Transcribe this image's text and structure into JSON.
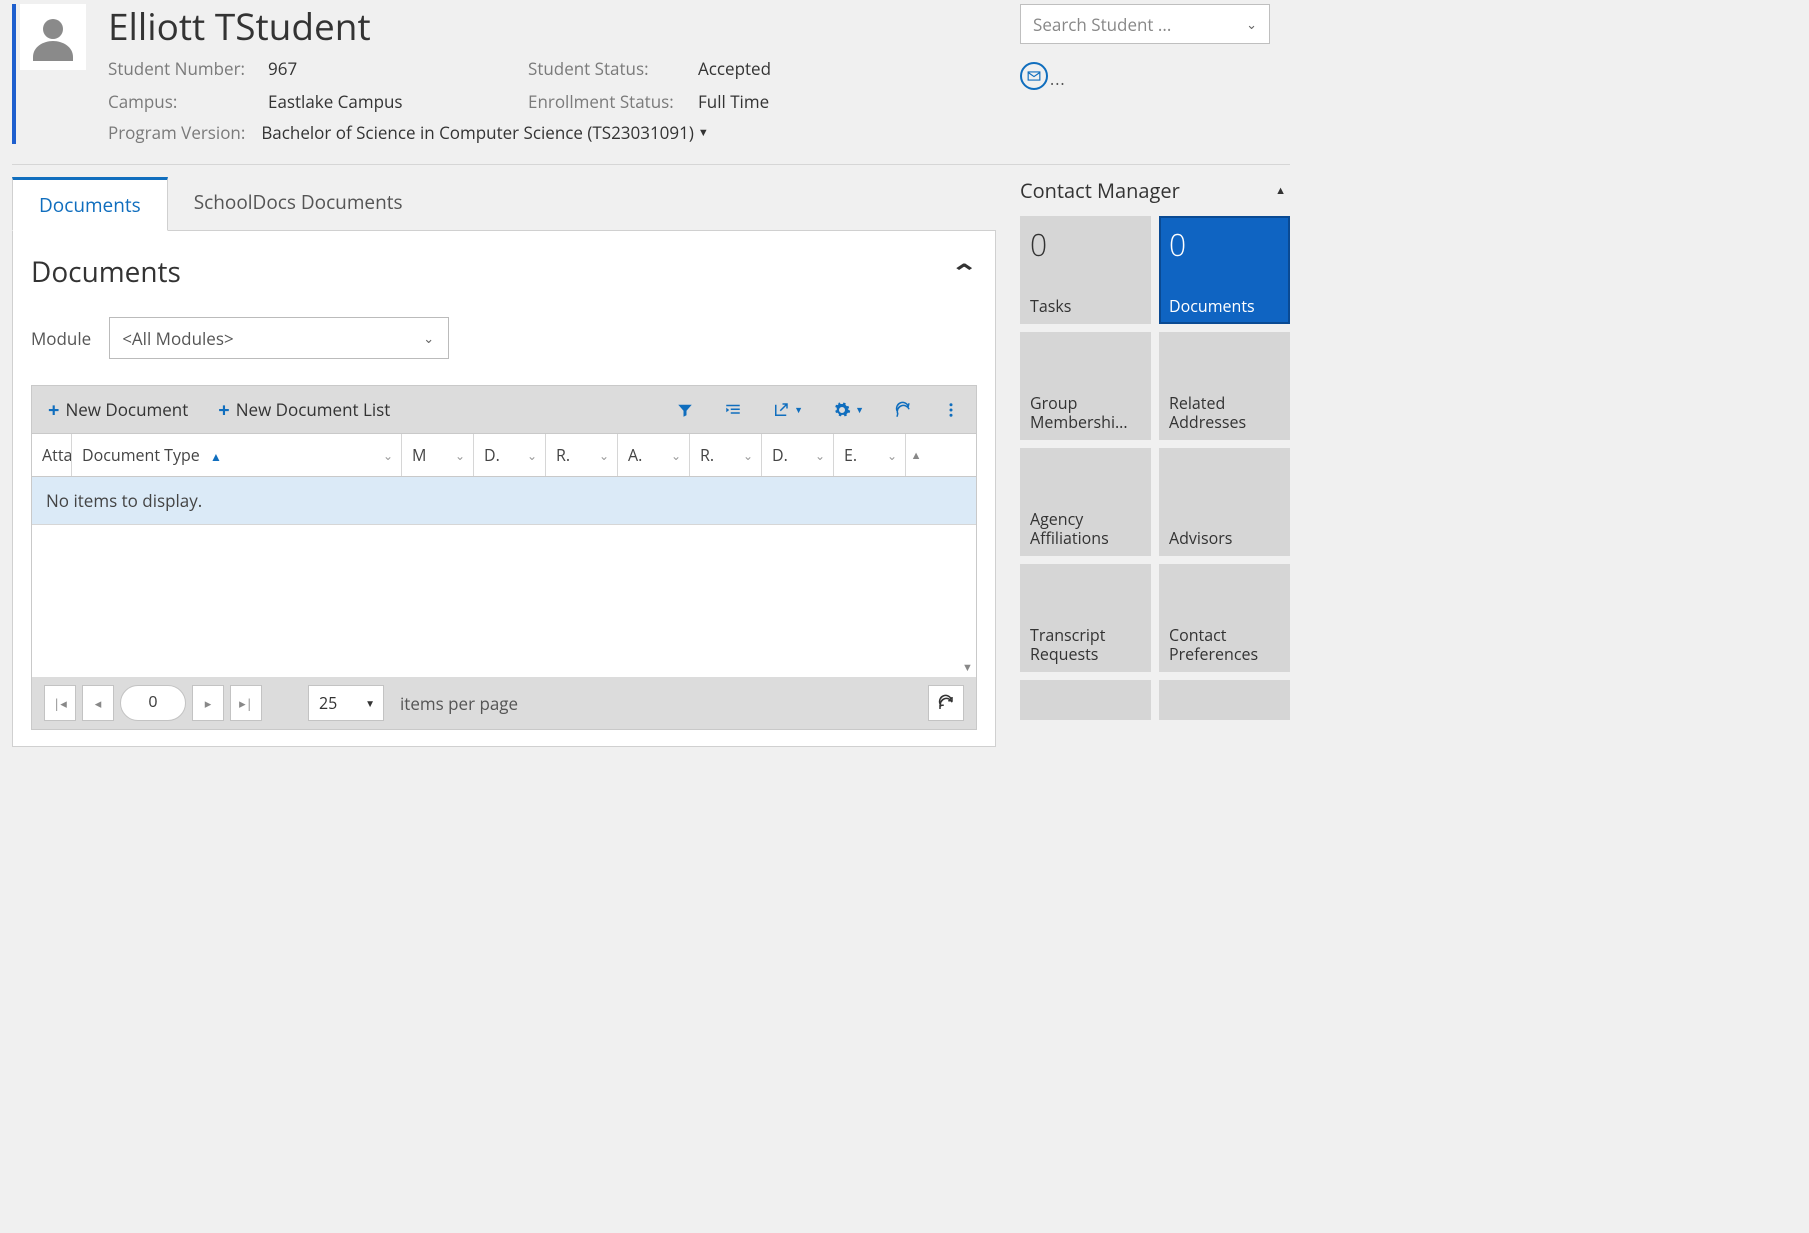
{
  "header": {
    "student_name": "Elliott TStudent",
    "labels": {
      "student_number": "Student Number:",
      "campus": "Campus:",
      "program_version": "Program Version:",
      "student_status": "Student Status:",
      "enrollment_status": "Enrollment Status:"
    },
    "values": {
      "student_number": "967",
      "campus": "Eastlake Campus",
      "program_version": "Bachelor of Science in Computer Science (TS23031091)",
      "student_status": "Accepted",
      "enrollment_status": "Full Time"
    },
    "search_placeholder": "Search Student ...",
    "mail_dots": "..."
  },
  "tabs": {
    "documents": "Documents",
    "schooldocs": "SchoolDocs Documents"
  },
  "documents": {
    "section_title": "Documents",
    "module_label": "Module",
    "module_value": "<All Modules>",
    "toolbar": {
      "new_document": "New Document",
      "new_document_list": "New Document List"
    },
    "columns": {
      "attachment": "Atta",
      "document_type": "Document Type",
      "c1": "M",
      "c2": "D.",
      "c3": "R.",
      "c4": "A.",
      "c5": "R.",
      "c6": "D.",
      "c7": "E."
    },
    "no_items": "No items to display.",
    "pager": {
      "page": "0",
      "page_size": "25",
      "items_per_page": "items per page"
    }
  },
  "contact_manager": {
    "title": "Contact Manager",
    "tiles": {
      "tasks": {
        "count": "0",
        "label": "Tasks"
      },
      "documents": {
        "count": "0",
        "label": "Documents"
      },
      "group_memberships": {
        "label": "Group Membershi..."
      },
      "related_addresses": {
        "label": "Related Addresses"
      },
      "agency_affiliations": {
        "label": "Agency Affiliations"
      },
      "advisors": {
        "label": "Advisors"
      },
      "transcript_requests": {
        "label": "Transcript Requests"
      },
      "contact_preferences": {
        "label": "Contact Preferences"
      }
    }
  }
}
